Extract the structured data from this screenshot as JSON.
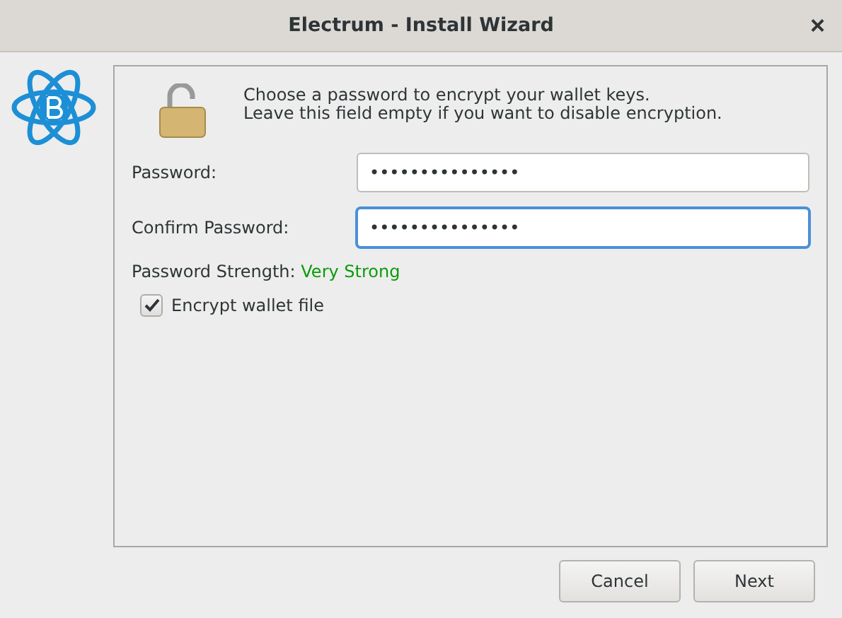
{
  "window": {
    "title": "Electrum  -  Install Wizard",
    "close": "×"
  },
  "message": [
    "Choose a password to encrypt your wallet keys.",
    "Leave this field empty if you want to disable encryption."
  ],
  "fields": [
    {
      "label": "Password:",
      "value": "•••••••••••••••",
      "focused": false
    },
    {
      "label": "Confirm Password:",
      "value": "•••••••••••••••",
      "focused": true
    }
  ],
  "strength": {
    "label": "Password Strength:",
    "value": "Very Strong",
    "color": "#0a9b0a"
  },
  "encrypt": {
    "label": "Encrypt wallet file",
    "checked": true
  },
  "buttons": [
    "Cancel",
    "Next"
  ]
}
